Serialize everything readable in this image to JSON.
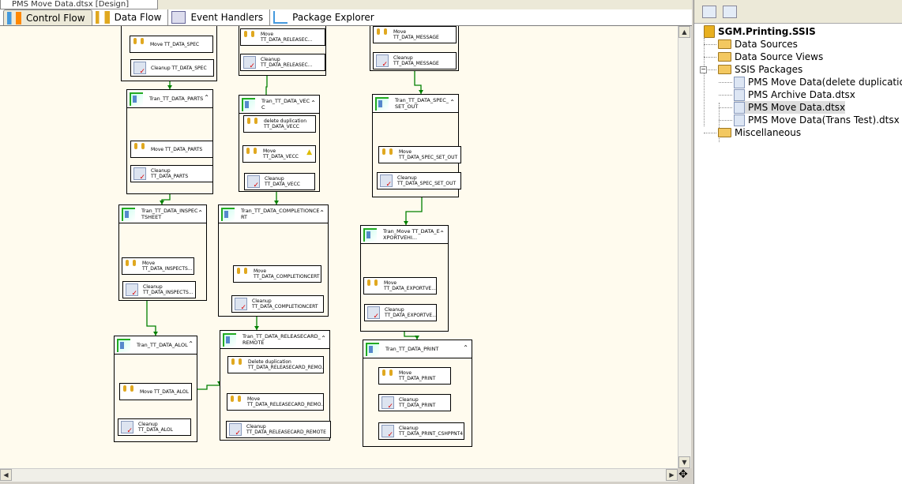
{
  "window": {
    "title": "PMS Move Data.dtsx [Design]"
  },
  "tabs": [
    {
      "label": "Control Flow",
      "icon": "control-flow-icon",
      "active": true
    },
    {
      "label": "Data Flow",
      "icon": "data-flow-icon"
    },
    {
      "label": "Event Handlers",
      "icon": "event-handlers-icon"
    },
    {
      "label": "Package Explorer",
      "icon": "package-explorer-icon"
    }
  ],
  "containers": [
    {
      "title": "",
      "tasks": [
        {
          "type": "move",
          "l1": "Move TT_DATA_SPEC",
          "l2": ""
        },
        {
          "type": "cleanup",
          "l1": "Cleanup TT_DATA_SPEC",
          "l2": ""
        }
      ]
    },
    {
      "title": "",
      "tasks": [
        {
          "type": "move",
          "l1": "Move",
          "l2": "TT_DATA_RELEASEC..."
        },
        {
          "type": "cleanup",
          "l1": "Cleanup",
          "l2": "TT_DATA_RELEASEC..."
        }
      ]
    },
    {
      "title": "",
      "tasks": [
        {
          "type": "move",
          "l1": "Move",
          "l2": "TT_DATA_MESSAGE"
        },
        {
          "type": "cleanup",
          "l1": "Cleanup",
          "l2": "TT_DATA_MESSAGE"
        }
      ]
    },
    {
      "title": "Tran_TT_DATA_PARTS",
      "tasks": [
        {
          "type": "move",
          "l1": "Move TT_DATA_PARTS",
          "l2": ""
        },
        {
          "type": "cleanup",
          "l1": "Cleanup",
          "l2": "TT_DATA_PARTS"
        }
      ]
    },
    {
      "title": "Tran_TT_DATA_VECC",
      "tasks": [
        {
          "type": "move",
          "l1": "delete duplication",
          "l2": "TT_DATA_VECC"
        },
        {
          "type": "move",
          "l1": "Move",
          "l2": "TT_DATA_VECC",
          "warning": true
        },
        {
          "type": "cleanup",
          "l1": "Cleanup",
          "l2": "TT_DATA_VECC"
        }
      ]
    },
    {
      "title": "Tran_TT_DATA_SPEC_SET_OUT",
      "tasks": [
        {
          "type": "move",
          "l1": "Move",
          "l2": "TT_DATA_SPEC_SET_OUT"
        },
        {
          "type": "cleanup",
          "l1": "Cleanup",
          "l2": "TT_DATA_SPEC_SET_OUT"
        }
      ]
    },
    {
      "title": "Tran_TT_DATA_INSPECTSHEET",
      "tasks": [
        {
          "type": "move",
          "l1": "Move",
          "l2": "TT_DATA_INSPECTS..."
        },
        {
          "type": "cleanup",
          "l1": "Cleanup",
          "l2": "TT_DATA_INSPECTS..."
        }
      ]
    },
    {
      "title": "Tran_TT_DATA_COMPLETIONCERT",
      "tasks": [
        {
          "type": "move",
          "l1": "Move",
          "l2": "TT_DATA_COMPLETIONCERT"
        },
        {
          "type": "cleanup",
          "l1": "Cleanup",
          "l2": "TT_DATA_COMPLETIONCERT"
        }
      ]
    },
    {
      "title": "Tran_Move TT_DATA_EXPORTVEHI...",
      "tasks": [
        {
          "type": "move",
          "l1": "Move",
          "l2": "TT_DATA_EXPORTVE..."
        },
        {
          "type": "cleanup",
          "l1": "Cleanup",
          "l2": "TT_DATA_EXPORTVE..."
        }
      ]
    },
    {
      "title": "Tran_TT_DATA_ALOL",
      "tasks": [
        {
          "type": "move",
          "l1": "Move TT_DATA_ALOL",
          "l2": ""
        },
        {
          "type": "cleanup",
          "l1": "Cleanup",
          "l2": "TT_DATA_ALOL"
        }
      ]
    },
    {
      "title": "Tran_TT_DATA_RELEASECARD_REMOTE",
      "tasks": [
        {
          "type": "move",
          "l1": "Delete duplication",
          "l2": "TT_DATA_RELEASECARD_REMO..."
        },
        {
          "type": "move",
          "l1": "Move",
          "l2": "TT_DATA_RELEASECARD_REMO..."
        },
        {
          "type": "cleanup",
          "l1": "Cleanup",
          "l2": "TT_DATA_RELEASECARD_REMOTE"
        }
      ]
    },
    {
      "title": "Tran_TT_DATA_PRINT",
      "tasks": [
        {
          "type": "move",
          "l1": "Move",
          "l2": "TT_DATA_PRINT"
        },
        {
          "type": "cleanup",
          "l1": "Cleanup",
          "l2": "TT_DATA_PRINT"
        },
        {
          "type": "cleanup",
          "l1": "Cleanup",
          "l2": "TT_DATA_PRINT_CSHPPNT4"
        }
      ]
    }
  ],
  "solution": {
    "project": "SGM.Printing.SSIS",
    "items": [
      {
        "label": "Data Sources",
        "icon": "folder-icon"
      },
      {
        "label": "Data Source Views",
        "icon": "folder-icon"
      },
      {
        "label": "SSIS Packages",
        "icon": "folder-icon",
        "expanded": true
      },
      {
        "label": "PMS Move Data(delete duplication).dtsx",
        "icon": "package-icon"
      },
      {
        "label": "PMS Archive Data.dtsx",
        "icon": "package-icon"
      },
      {
        "label": "PMS Move Data.dtsx",
        "icon": "package-icon",
        "selected": true
      },
      {
        "label": "PMS Move Data(Trans Test).dtsx",
        "icon": "package-icon"
      },
      {
        "label": "Miscellaneous",
        "icon": "folder-icon"
      }
    ]
  },
  "colors": {
    "canvas": "#fffbee",
    "connector": "#008000"
  }
}
